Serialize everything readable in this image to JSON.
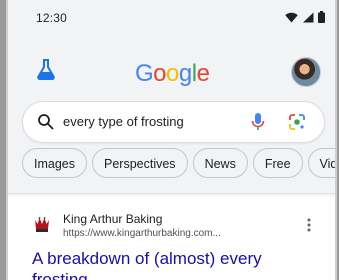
{
  "status_bar": {
    "time": "12:30"
  },
  "header": {
    "labs_icon": "flask-icon",
    "logo": {
      "letters": [
        "G",
        "o",
        "o",
        "g",
        "l",
        "e"
      ],
      "colors": [
        "#4285F4",
        "#EA4335",
        "#FBBC05",
        "#4285F4",
        "#34A853",
        "#EA4335"
      ]
    },
    "avatar_icon": "profile-avatar"
  },
  "search": {
    "query": "every type of frosting",
    "icons": [
      "search-icon",
      "mic-icon",
      "lens-icon"
    ]
  },
  "chips": [
    {
      "label": "Images"
    },
    {
      "label": "Perspectives"
    },
    {
      "label": "News"
    },
    {
      "label": "Free"
    },
    {
      "label": "Vide"
    }
  ],
  "result": {
    "site_name": "King Arthur Baking",
    "url": "https://www.kingarthurbaking.com...",
    "title": "A breakdown of (almost) every frosting"
  },
  "colors": {
    "link": "#1a0dab",
    "mic": "#4285F4",
    "background": "#f1f3f4"
  }
}
